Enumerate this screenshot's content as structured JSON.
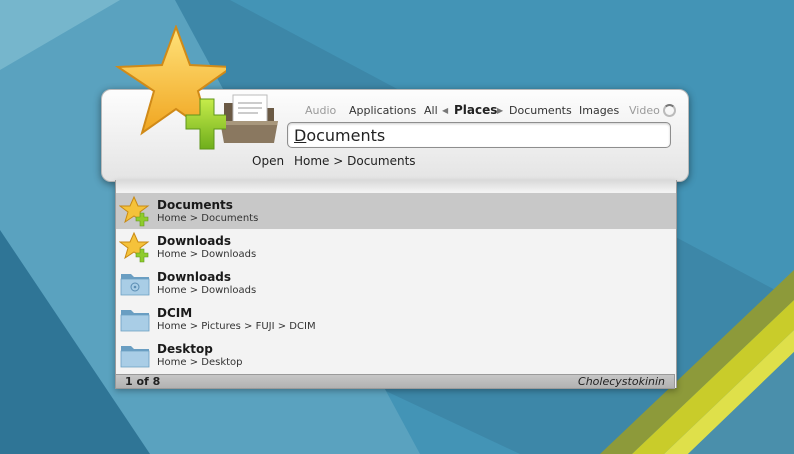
{
  "categories": {
    "items": [
      {
        "label": "Audio",
        "state": "faded"
      },
      {
        "label": "Applications",
        "state": "normal"
      },
      {
        "label": "All",
        "state": "normal"
      },
      {
        "label": "Places",
        "state": "active"
      },
      {
        "label": "Documents",
        "state": "normal"
      },
      {
        "label": "Images",
        "state": "normal"
      },
      {
        "label": "Video",
        "state": "faded"
      }
    ]
  },
  "search": {
    "first_letter": "D",
    "rest": "ocuments"
  },
  "action": {
    "label": "Open",
    "target": "Home > Documents"
  },
  "results": [
    {
      "name": "Documents",
      "path": "Home > Documents",
      "icon": "star-add-icon",
      "selected": true
    },
    {
      "name": "Downloads",
      "path": "Home > Downloads",
      "icon": "star-add-icon",
      "selected": false
    },
    {
      "name": "Downloads",
      "path": "Home > Downloads",
      "icon": "download-folder-icon",
      "selected": false
    },
    {
      "name": "DCIM",
      "path": "Home > Pictures > FUJI > DCIM",
      "icon": "folder-icon",
      "selected": false
    },
    {
      "name": "Desktop",
      "path": "Home > Desktop",
      "icon": "folder-icon",
      "selected": false
    }
  ],
  "status": {
    "count": "1 of 8",
    "user": "Cholecystokinin"
  },
  "colors": {
    "wallpaper": "#3f8fb0",
    "selection": "#c8c8c8",
    "accent_yellow": "#c9cc2a"
  }
}
